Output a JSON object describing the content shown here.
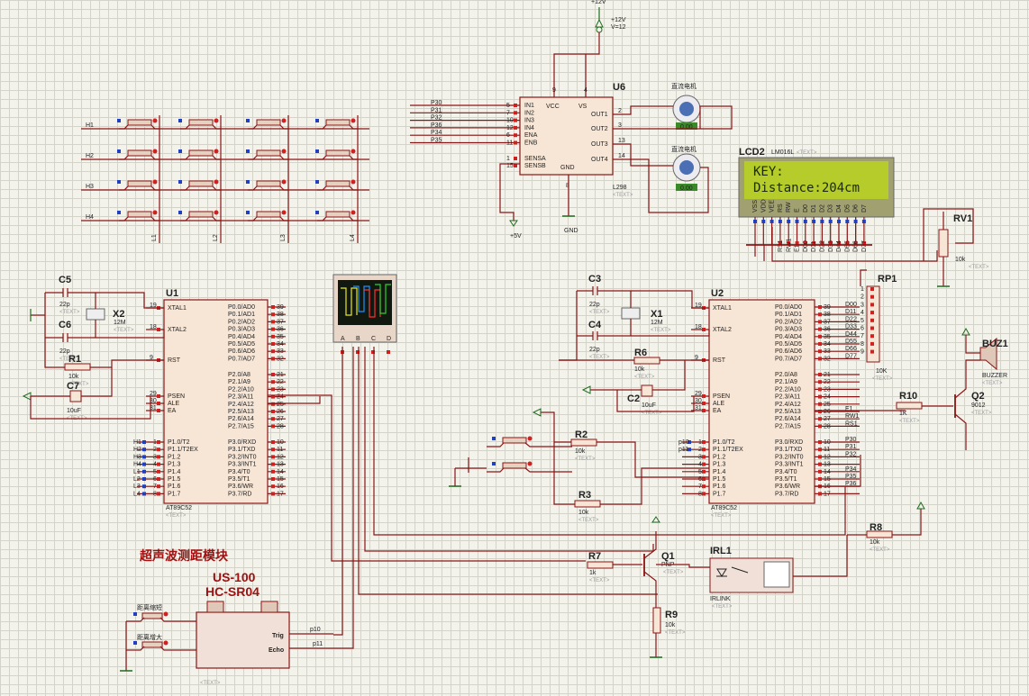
{
  "colors": {
    "wire": "#8b1414",
    "chip_fill": "#f7e6d6",
    "grid_bg": "#f3f3ec",
    "lcd_screen": "#b5cc2a",
    "title_red": "#a01010"
  },
  "power": {
    "vcc_label": "+12V",
    "vcc_value": "V=12",
    "plus5": "+5V",
    "gnd": "GND"
  },
  "u6": {
    "ref": "U6",
    "part": "L298",
    "text": "<TEXT>",
    "inputs": [
      {
        "net": "P30",
        "pin": "5",
        "name": "IN1"
      },
      {
        "net": "P31",
        "pin": "7",
        "name": "IN2"
      },
      {
        "net": "P32",
        "pin": "10",
        "name": "IN3"
      },
      {
        "net": "P36",
        "pin": "12",
        "name": "IN4"
      },
      {
        "net": "P34",
        "pin": "6",
        "name": "ENA"
      },
      {
        "net": "P35",
        "pin": "11",
        "name": "ENB"
      }
    ],
    "sense": [
      {
        "pin": "1",
        "name": "SENSA"
      },
      {
        "pin": "15",
        "name": "SENSB"
      }
    ],
    "outputs": [
      {
        "pin": "2",
        "name": "OUT1"
      },
      {
        "pin": "3",
        "name": "OUT2"
      },
      {
        "pin": "13",
        "name": "OUT3"
      },
      {
        "pin": "14",
        "name": "OUT4"
      }
    ],
    "top": [
      {
        "pin": "9",
        "name": "VCC"
      },
      {
        "pin": "4",
        "name": "VS"
      }
    ],
    "gnd": {
      "pin": "8",
      "name": "GND"
    }
  },
  "motors": [
    {
      "label": "直流电机",
      "value": "0.00"
    },
    {
      "label": "直流电机",
      "value": "0.00"
    }
  ],
  "lcd": {
    "ref": "LCD2",
    "part": "LM016L",
    "text": "<TEXT>",
    "line1": "KEY:",
    "line2": "Distance:204cm",
    "pins": [
      "VSS",
      "VDD",
      "VEE",
      "RS",
      "RW",
      "E",
      "D0",
      "D1",
      "D2",
      "D3",
      "D4",
      "D5",
      "D6",
      "D7"
    ],
    "nets": [
      "RS1",
      "RW1",
      "E1",
      "D00",
      "D11",
      "D22",
      "D33",
      "D44",
      "D55",
      "D66",
      "D77"
    ]
  },
  "rv1": {
    "ref": "RV1",
    "value": "10k",
    "text": "<TEXT>"
  },
  "rp1": {
    "ref": "RP1",
    "value": "10K",
    "text": "<TEXT>",
    "pins": [
      "1",
      "2",
      "3",
      "4",
      "5",
      "6",
      "7",
      "8",
      "9"
    ]
  },
  "keypad": {
    "rows": [
      "H1",
      "H2",
      "H3",
      "H4"
    ],
    "cols": [
      "L1",
      "L2",
      "L3",
      "L4"
    ]
  },
  "u1": {
    "ref": "U1",
    "part": "AT89C52",
    "text": "<TEXT>",
    "left": [
      {
        "pin": "19",
        "name": "XTAL1"
      },
      {
        "pin": "18",
        "name": "XTAL2"
      },
      {
        "pin": "9",
        "name": "RST"
      },
      {
        "pin": "29",
        "name": "PSEN"
      },
      {
        "pin": "30",
        "name": "ALE"
      },
      {
        "pin": "31",
        "name": "EA"
      }
    ],
    "right": [
      {
        "pin": "39",
        "name": "P0.0/AD0"
      },
      {
        "pin": "38",
        "name": "P0.1/AD1"
      },
      {
        "pin": "37",
        "name": "P0.2/AD2"
      },
      {
        "pin": "36",
        "name": "P0.3/AD3"
      },
      {
        "pin": "35",
        "name": "P0.4/AD4"
      },
      {
        "pin": "34",
        "name": "P0.5/AD5"
      },
      {
        "pin": "33",
        "name": "P0.6/AD6"
      },
      {
        "pin": "32",
        "name": "P0.7/AD7"
      },
      {
        "pin": "21",
        "name": "P2.0/A8"
      },
      {
        "pin": "22",
        "name": "P2.1/A9"
      },
      {
        "pin": "23",
        "name": "P2.2/A10"
      },
      {
        "pin": "24",
        "name": "P2.3/A11"
      },
      {
        "pin": "25",
        "name": "P2.4/A12"
      },
      {
        "pin": "26",
        "name": "P2.5/A13"
      },
      {
        "pin": "27",
        "name": "P2.6/A14"
      },
      {
        "pin": "28",
        "name": "P2.7/A15"
      },
      {
        "pin": "10",
        "name": "P3.0/RXD"
      },
      {
        "pin": "11",
        "name": "P3.1/TXD"
      },
      {
        "pin": "12",
        "name": "P3.2/INT0"
      },
      {
        "pin": "13",
        "name": "P3.3/INT1"
      },
      {
        "pin": "14",
        "name": "P3.4/T0"
      },
      {
        "pin": "15",
        "name": "P3.5/T1"
      },
      {
        "pin": "16",
        "name": "P3.6/WR"
      },
      {
        "pin": "17",
        "name": "P3.7/RD"
      }
    ],
    "port1": [
      {
        "net": "H1",
        "pin": "1",
        "name": "P1.0/T2"
      },
      {
        "net": "H2",
        "pin": "2",
        "name": "P1.1/T2EX"
      },
      {
        "net": "H3",
        "pin": "3",
        "name": "P1.2"
      },
      {
        "net": "H4",
        "pin": "4",
        "name": "P1.3"
      },
      {
        "net": "L1",
        "pin": "5",
        "name": "P1.4"
      },
      {
        "net": "L2",
        "pin": "6",
        "name": "P1.5"
      },
      {
        "net": "L3",
        "pin": "7",
        "name": "P1.6"
      },
      {
        "net": "L4",
        "pin": "8",
        "name": "P1.7"
      }
    ]
  },
  "u2": {
    "ref": "U2",
    "part": "AT89C52",
    "text": "<TEXT>",
    "left": [
      {
        "pin": "19",
        "name": "XTAL1"
      },
      {
        "pin": "18",
        "name": "XTAL2"
      },
      {
        "pin": "9",
        "name": "RST"
      },
      {
        "pin": "29",
        "name": "PSEN"
      },
      {
        "pin": "30",
        "name": "ALE"
      },
      {
        "pin": "31",
        "name": "EA"
      }
    ],
    "right_nets": [
      "D00",
      "D11",
      "D22",
      "D33",
      "D44",
      "D55",
      "D66",
      "D77",
      "",
      "",
      "",
      "",
      "",
      "E1",
      "RW1",
      "RS1",
      "P30",
      "P31",
      "P32",
      "",
      "P34",
      "P35",
      "P36",
      ""
    ],
    "port1": [
      {
        "net": "p10",
        "pin": "1",
        "name": "P1.0/T2"
      },
      {
        "net": "p11",
        "pin": "2",
        "name": "P1.1/T2EX"
      },
      {
        "net": "",
        "pin": "3",
        "name": "P1.2"
      },
      {
        "net": "",
        "pin": "4",
        "name": "P1.3"
      },
      {
        "net": "",
        "pin": "5",
        "name": "P1.4"
      },
      {
        "net": "",
        "pin": "6",
        "name": "P1.5"
      },
      {
        "net": "",
        "pin": "7",
        "name": "P1.6"
      },
      {
        "net": "",
        "pin": "8",
        "name": "P1.7"
      }
    ]
  },
  "caps": [
    {
      "ref": "C5",
      "value": "22p"
    },
    {
      "ref": "C6",
      "value": "22p"
    },
    {
      "ref": "C7",
      "value": "10uF"
    },
    {
      "ref": "C3",
      "value": "22p"
    },
    {
      "ref": "C4",
      "value": "22p"
    },
    {
      "ref": "C2",
      "value": "10uF"
    }
  ],
  "crystals": [
    {
      "ref": "X2",
      "value": "12M"
    },
    {
      "ref": "X1",
      "value": "12M"
    }
  ],
  "resistors": [
    {
      "ref": "R1",
      "value": "10k"
    },
    {
      "ref": "R6",
      "value": "10k"
    },
    {
      "ref": "R2",
      "value": "10k"
    },
    {
      "ref": "R3",
      "value": "10k"
    },
    {
      "ref": "R7",
      "value": "1k"
    },
    {
      "ref": "R8",
      "value": "10k"
    },
    {
      "ref": "R9",
      "value": "10k"
    },
    {
      "ref": "R10",
      "value": "1K"
    }
  ],
  "q1": {
    "ref": "Q1",
    "type": "PNP"
  },
  "q2": {
    "ref": "Q2",
    "type": "9012"
  },
  "buz": {
    "ref": "BUZ1",
    "type": "BUZZER"
  },
  "irl": {
    "ref": "IRL1",
    "type": "IRLINK"
  },
  "scope": {
    "channels": [
      "A",
      "B",
      "C",
      "D"
    ]
  },
  "module": {
    "title": "超声波测距模块",
    "line1": "US-100",
    "line2": "HC-SR04",
    "trig": "Trig",
    "echo": "Echo",
    "net_trig": "p10",
    "net_echo": "p11",
    "btn1": "距离缩短",
    "btn2": "距离增大",
    "text": "<TEXT>"
  },
  "text_tag": "<TEXT>"
}
